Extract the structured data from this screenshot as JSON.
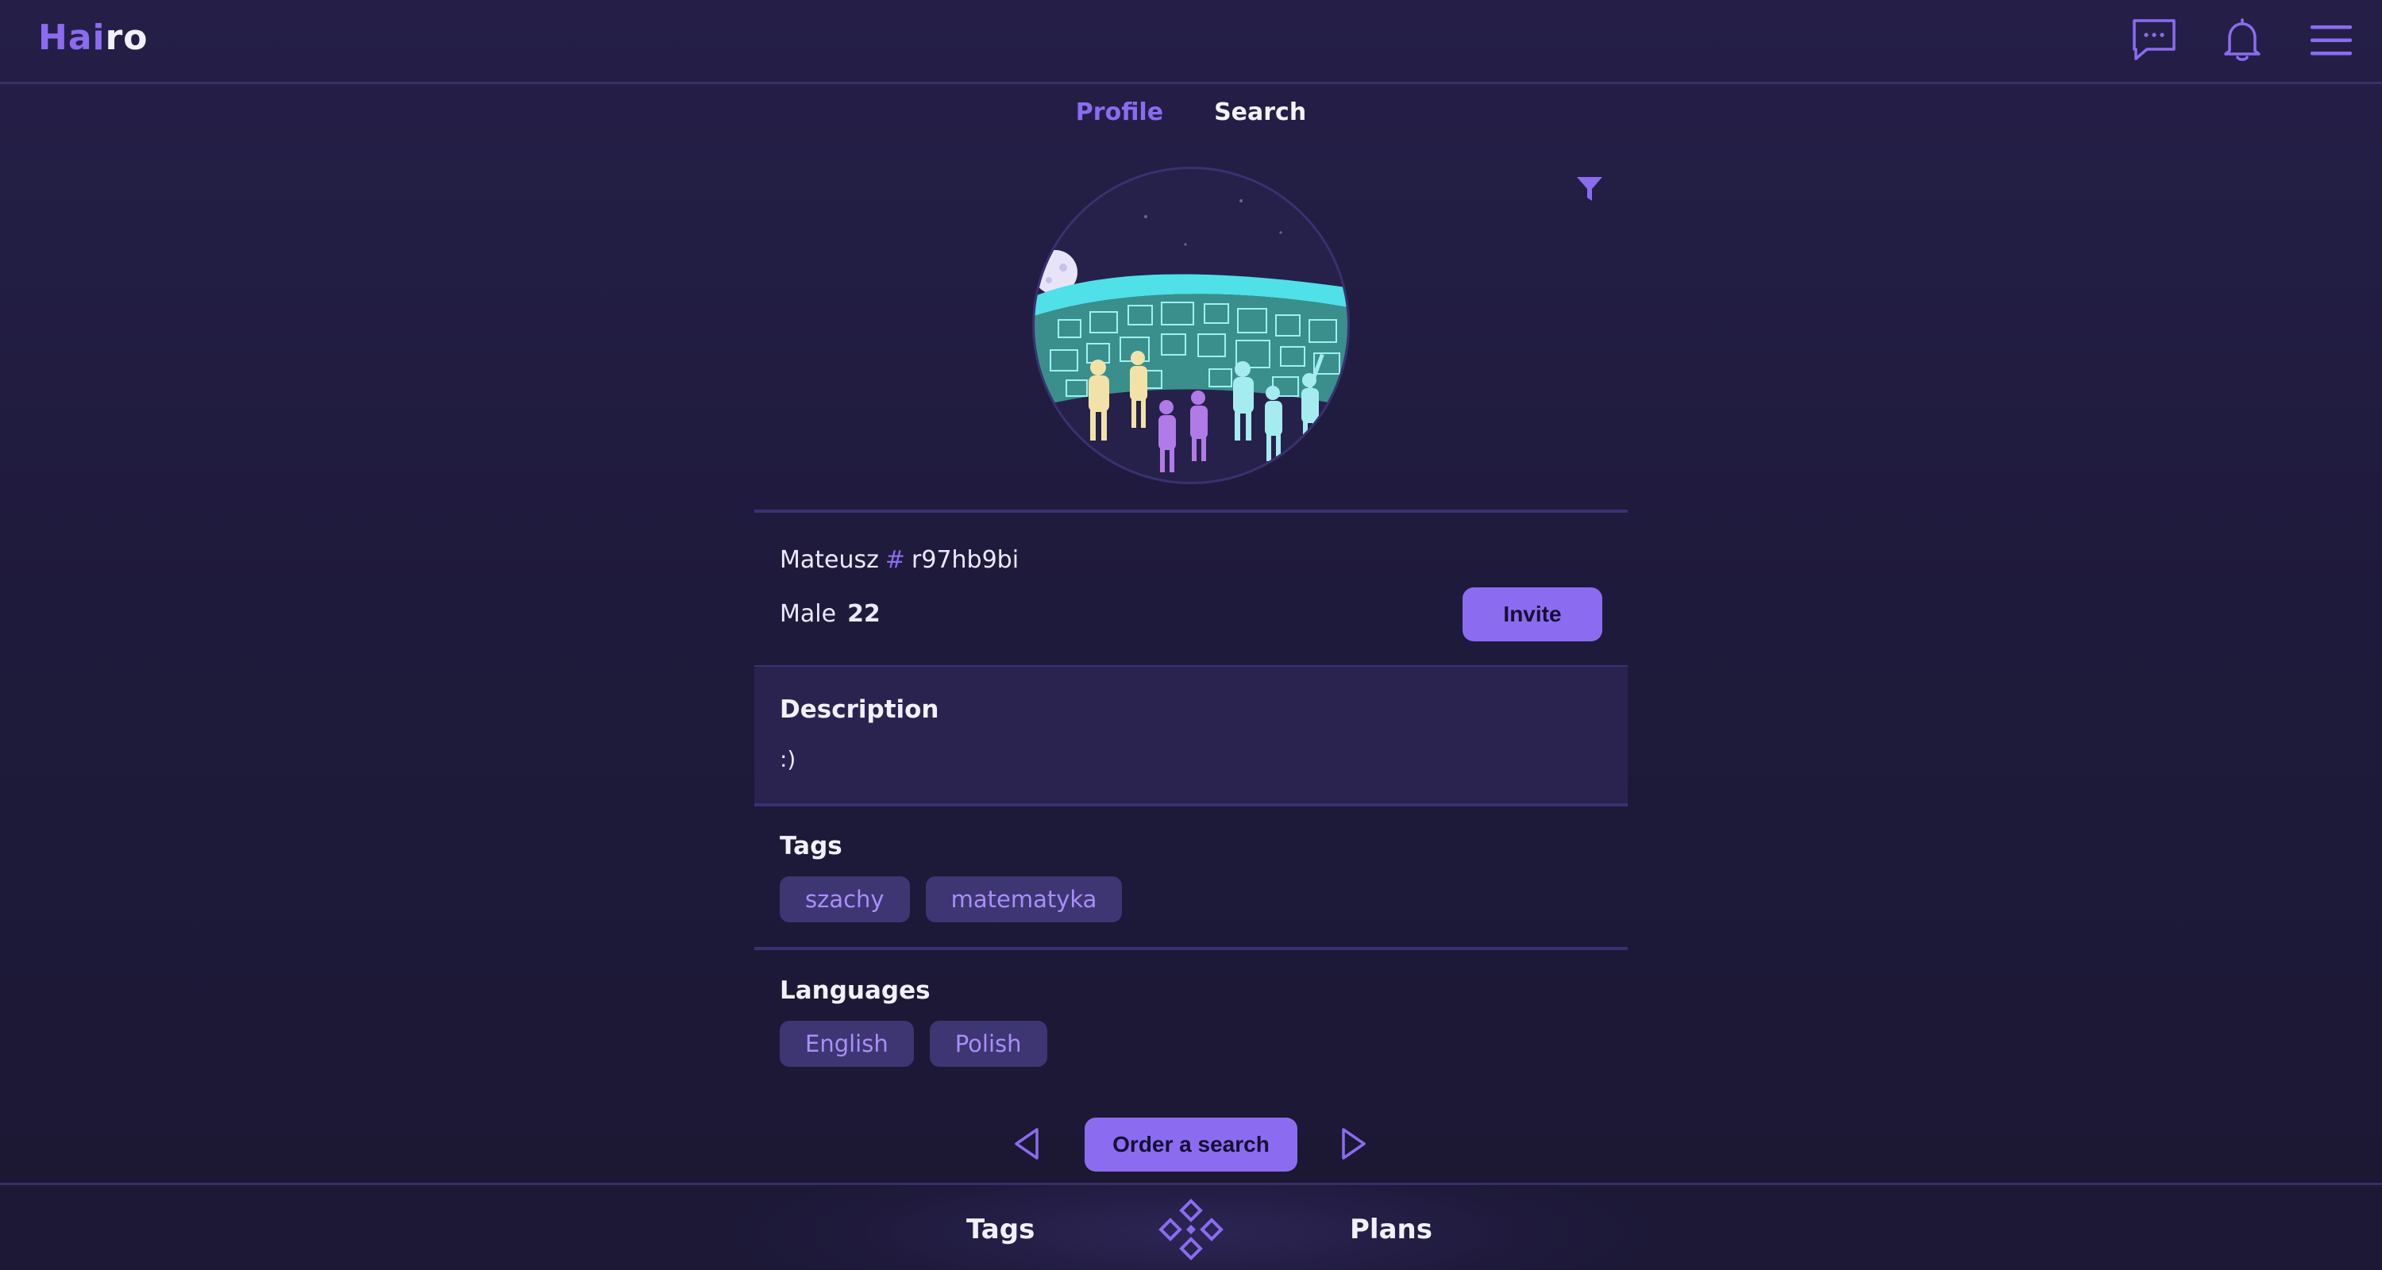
{
  "app": {
    "logo_accent": "Hai",
    "logo_rest": "ro"
  },
  "header": {
    "icons": [
      "chat-icon",
      "bell-icon",
      "menu-icon"
    ]
  },
  "tabs": [
    {
      "label": "Profile",
      "active": true
    },
    {
      "label": "Search",
      "active": false
    }
  ],
  "profile": {
    "name": "Mateusz",
    "hash_symbol": "#",
    "id": "r97hb9bi",
    "gender": "Male",
    "age": "22",
    "invite_label": "Invite",
    "description_title": "Description",
    "description": ":)",
    "tags_title": "Tags",
    "tags": [
      "szachy",
      "matematyka"
    ],
    "languages_title": "Languages",
    "languages": [
      "English",
      "Polish"
    ]
  },
  "pager": {
    "order_label": "Order a search"
  },
  "bottom_nav": {
    "left": "Tags",
    "right": "Plans"
  },
  "colors": {
    "accent": "#8b6cf0",
    "background": "#221d42",
    "chip_bg": "#3e3573",
    "chip_text": "#a88ff7"
  }
}
